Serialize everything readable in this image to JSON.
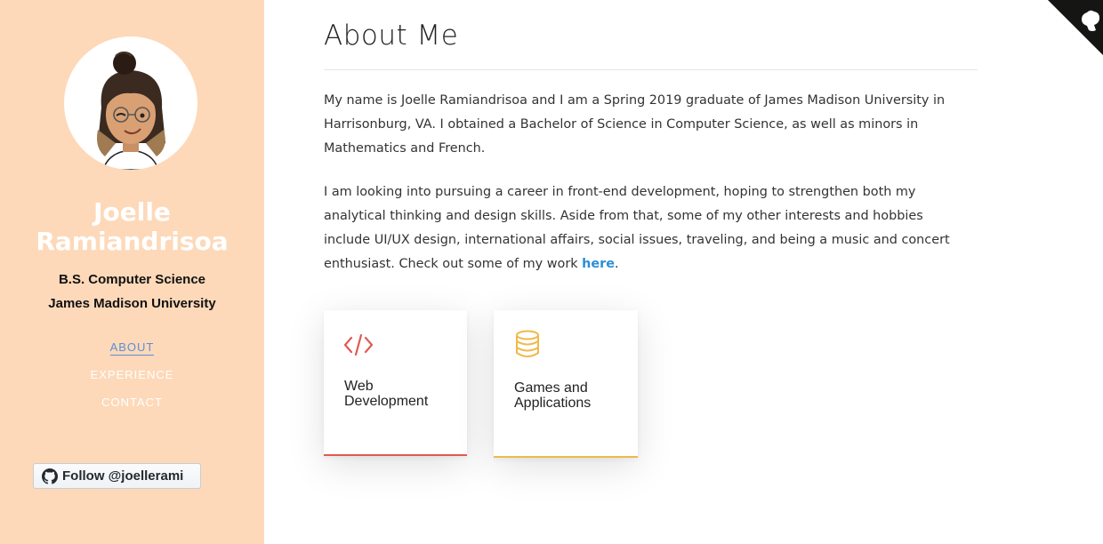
{
  "sidebar": {
    "name": "Joelle Ramiandrisoa",
    "degree": "B.S. Computer Science",
    "school": "James Madison University",
    "nav": [
      {
        "label": "ABOUT",
        "active": true
      },
      {
        "label": "EXPERIENCE",
        "active": false
      },
      {
        "label": "CONTACT",
        "active": false
      }
    ],
    "follow_button": "Follow @joellerami",
    "background": "#fdd9b9"
  },
  "main": {
    "title": "About Me",
    "paragraph1": "My name is Joelle Ramiandrisoa and I am a Spring 2019 graduate of James Madison University in Harrisonburg, VA. I obtained a Bachelor of Science in Computer Science, as well as minors in Mathematics and French.",
    "paragraph2_text": "I am looking into pursuing a career in front-end development, hoping to strengthen both my analytical thinking and design skills. Aside from that, some of my other interests and hobbies include UI/UX design, international affairs, social issues, traveling, and being a music and concert enthusiast. Check out some of my work ",
    "paragraph2_link": "here",
    "paragraph2_end": ".",
    "cards": [
      {
        "label": "Web Development",
        "icon": "code-icon",
        "accent": "#e05a55"
      },
      {
        "label": "Games and Applications",
        "icon": "database-icon",
        "accent": "#f0b94a"
      }
    ]
  },
  "corner": {
    "icon": "github-octocat-corner-icon"
  }
}
